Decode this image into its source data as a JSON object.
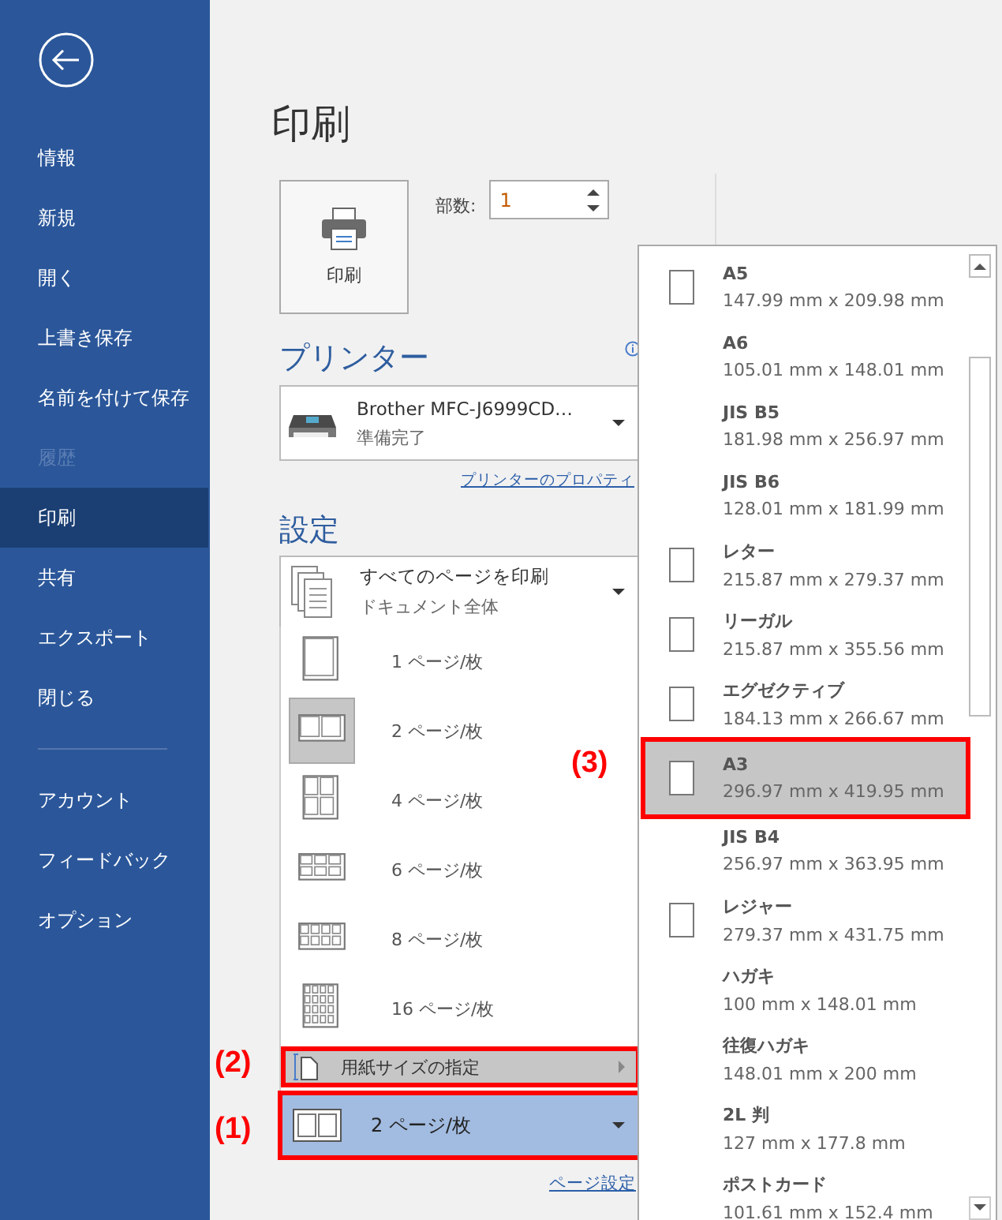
{
  "sidebar": {
    "items": [
      {
        "label": "情報",
        "selected": false,
        "disabled": false
      },
      {
        "label": "新規",
        "selected": false,
        "disabled": false
      },
      {
        "label": "開く",
        "selected": false,
        "disabled": false
      },
      {
        "label": "上書き保存",
        "selected": false,
        "disabled": false
      },
      {
        "label": "名前を付けて保存",
        "selected": false,
        "disabled": false
      },
      {
        "label": "履歴",
        "selected": false,
        "disabled": true
      },
      {
        "label": "印刷",
        "selected": true,
        "disabled": false
      },
      {
        "label": "共有",
        "selected": false,
        "disabled": false
      },
      {
        "label": "エクスポート",
        "selected": false,
        "disabled": false
      },
      {
        "label": "閉じる",
        "selected": false,
        "disabled": false
      }
    ],
    "footer_items": [
      {
        "label": "アカウント",
        "selected": false,
        "disabled": false
      },
      {
        "label": "フィードバック",
        "selected": false,
        "disabled": false
      },
      {
        "label": "オプション",
        "selected": false,
        "disabled": false
      }
    ]
  },
  "title": "印刷",
  "print_button": {
    "label": "印刷"
  },
  "copies": {
    "label": "部数:",
    "value": "1"
  },
  "printer": {
    "heading": "プリンター",
    "name": "Brother MFC-J6999CD…",
    "status": "準備完了",
    "properties_link": "プリンターのプロパティ"
  },
  "settings": {
    "heading": "設定",
    "range": {
      "title": "すべてのページを印刷",
      "subtitle": "ドキュメント全体"
    },
    "pages_menu": [
      {
        "kind": "one",
        "label": "1 ページ/枚",
        "selected": false
      },
      {
        "kind": "two",
        "label": "2 ページ/枚",
        "selected": true
      },
      {
        "kind": "four",
        "label": "4 ページ/枚",
        "selected": false
      },
      {
        "kind": "six",
        "label": "6 ページ/枚",
        "selected": false
      },
      {
        "kind": "eight",
        "label": "8 ページ/枚",
        "selected": false
      },
      {
        "kind": "sixteen",
        "label": "16 ページ/枚",
        "selected": false
      }
    ],
    "paper_size_item": {
      "label": "用紙サイズの指定"
    },
    "pages_dropdown": {
      "label": "2 ページ/枚"
    },
    "page_setup_link": "ページ設定"
  },
  "paper_sizes": [
    {
      "kind": "sheet",
      "name": "A5",
      "size": "147.99 mm x 209.98 mm",
      "selected": false
    },
    {
      "kind": "plain",
      "name": "A6",
      "size": "105.01 mm x 148.01 mm",
      "selected": false
    },
    {
      "kind": "plain",
      "name": "JIS B5",
      "size": "181.98 mm x 256.97 mm",
      "selected": false
    },
    {
      "kind": "plain",
      "name": "JIS B6",
      "size": "128.01 mm x 181.99 mm",
      "selected": false
    },
    {
      "kind": "sheet",
      "name": "レター",
      "size": "215.87 mm x 279.37 mm",
      "selected": false
    },
    {
      "kind": "sheet",
      "name": "リーガル",
      "size": "215.87 mm x 355.56 mm",
      "selected": false
    },
    {
      "kind": "sheet",
      "name": "エグゼクティブ",
      "size": "184.13 mm x 266.67 mm",
      "selected": false
    },
    {
      "kind": "sheet",
      "name": "A3",
      "size": "296.97 mm x 419.95 mm",
      "selected": true
    },
    {
      "kind": "plain",
      "name": "JIS B4",
      "size": "256.97 mm x 363.95 mm",
      "selected": false
    },
    {
      "kind": "sheet",
      "name": "レジャー",
      "size": "279.37 mm x 431.75 mm",
      "selected": false
    },
    {
      "kind": "plain",
      "name": "ハガキ",
      "size": "100 mm x 148.01 mm",
      "selected": false
    },
    {
      "kind": "plain",
      "name": "往復ハガキ",
      "size": "148.01 mm x 200 mm",
      "selected": false
    },
    {
      "kind": "plain",
      "name": "2L 判",
      "size": "127 mm x 177.8 mm",
      "selected": false
    },
    {
      "kind": "plain",
      "name": "ポストカード",
      "size": "101.61 mm x 152.4 mm",
      "selected": false
    }
  ],
  "annotations": [
    "(1)",
    "(2)",
    "(3)"
  ]
}
